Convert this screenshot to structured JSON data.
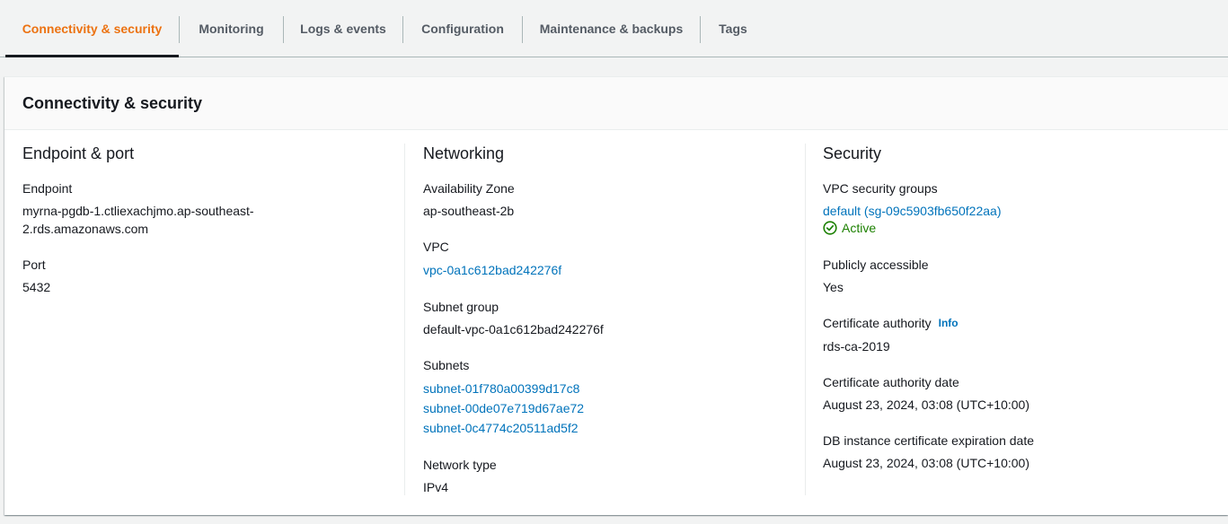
{
  "tabs": [
    {
      "label": "Connectivity & security",
      "active": true
    },
    {
      "label": "Monitoring"
    },
    {
      "label": "Logs & events"
    },
    {
      "label": "Configuration"
    },
    {
      "label": "Maintenance & backups"
    },
    {
      "label": "Tags"
    }
  ],
  "panel": {
    "title": "Connectivity & security"
  },
  "endpoint": {
    "title": "Endpoint & port",
    "endpoint_label": "Endpoint",
    "endpoint_value_line1": "myrna-pgdb-1.ctliexachjmo.ap-southeast-",
    "endpoint_value_line2": "2.rds.amazonaws.com",
    "port_label": "Port",
    "port_value": "5432"
  },
  "networking": {
    "title": "Networking",
    "az_label": "Availability Zone",
    "az_value": "ap-southeast-2b",
    "vpc_label": "VPC",
    "vpc_value": "vpc-0a1c612bad242276f",
    "subnet_group_label": "Subnet group",
    "subnet_group_value": "default-vpc-0a1c612bad242276f",
    "subnets_label": "Subnets",
    "subnets": [
      "subnet-01f780a00399d17c8",
      "subnet-00de07e719d67ae72",
      "subnet-0c4774c20511ad5f2"
    ],
    "network_type_label": "Network type",
    "network_type_value": "IPv4"
  },
  "security": {
    "title": "Security",
    "sg_label": "VPC security groups",
    "sg_value": "default (sg-09c5903fb650f22aa)",
    "sg_status": "Active",
    "public_label": "Publicly accessible",
    "public_value": "Yes",
    "ca_label": "Certificate authority",
    "ca_info": "Info",
    "ca_value": "rds-ca-2019",
    "ca_date_label": "Certificate authority date",
    "ca_date_value": "August 23, 2024, 03:08 (UTC+10:00)",
    "db_cert_label": "DB instance certificate expiration date",
    "db_cert_value": "August 23, 2024, 03:08 (UTC+10:00)"
  },
  "colors": {
    "accent": "#ec7211",
    "link": "#0073bb",
    "success": "#1d8102"
  },
  "icons": {
    "status": "check-circle-icon"
  }
}
